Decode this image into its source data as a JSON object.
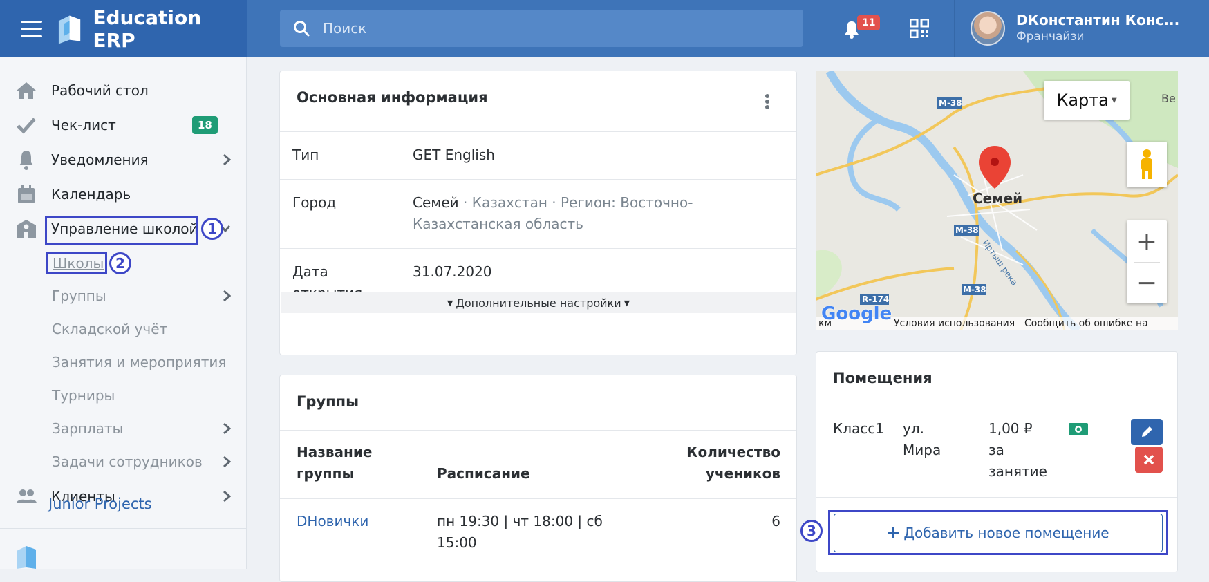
{
  "header": {
    "app_title": "Education ERP",
    "search_placeholder": "Поиск",
    "notifications_count": "11",
    "user_name": "DКонстантин Конс...",
    "user_role": "Франчайзи"
  },
  "sidebar": {
    "items": [
      {
        "label": "Рабочий стол",
        "icon": "home-icon"
      },
      {
        "label": "Чек-лист",
        "icon": "check-icon",
        "badge": "18"
      },
      {
        "label": "Уведомления",
        "icon": "bell-icon"
      },
      {
        "label": "Календарь",
        "icon": "calendar-icon"
      },
      {
        "label": "Управление школой",
        "icon": "school-icon"
      }
    ],
    "subitems": [
      "Школы",
      "Группы",
      "Складской учёт",
      "Занятия и мероприятия",
      "Турниры",
      "Зарплаты",
      "Задачи сотрудников"
    ],
    "clients_label": "Клиенты",
    "footer_label": "Junior Projects"
  },
  "annotations": [
    "1",
    "2",
    "3"
  ],
  "info": {
    "title": "Основная информация",
    "type_label": "Тип",
    "type_value": "GET English",
    "city_label": "Город",
    "city_value": "Семей",
    "city_sep1": " · ",
    "city_country": "Казахстан",
    "city_sep2": " · ",
    "city_region": "Регион: Восточно-Казахстанская область",
    "date_label": "Дата открытия",
    "date_value": "31.07.2020",
    "more_settings": "Дополнительные настройки"
  },
  "map": {
    "type_button": "Карта",
    "city_label": "Семей",
    "road_labels": [
      "M-38",
      "M-38",
      "M-38",
      "R-174"
    ],
    "river_label": "Иртыш река",
    "corner_label": "Ве",
    "footer_scale": "км",
    "footer_terms": "Условия использования",
    "footer_report": "Сообщить об ошибке на карте",
    "google": "Google"
  },
  "groups": {
    "title": "Группы",
    "col_name": "Название группы",
    "col_schedule": "Расписание",
    "col_count": "Количество учеников",
    "rows": [
      {
        "name": "DНовички",
        "schedule": "пн 19:30 | чт 18:00 | сб 15:00",
        "count": "6"
      }
    ]
  },
  "rooms": {
    "title": "Помещения",
    "rows": [
      {
        "name": "Класс1",
        "address": "ул. Мира",
        "price": "1,00 ₽",
        "price_note": "за занятие"
      }
    ],
    "add_button": "Добавить новое помещение"
  },
  "colors": {
    "header": "#3e74b8",
    "brand": "#2f65ae",
    "badge_green": "#1f9c76",
    "badge_red": "#e2514c",
    "highlight": "#3d47c7"
  }
}
